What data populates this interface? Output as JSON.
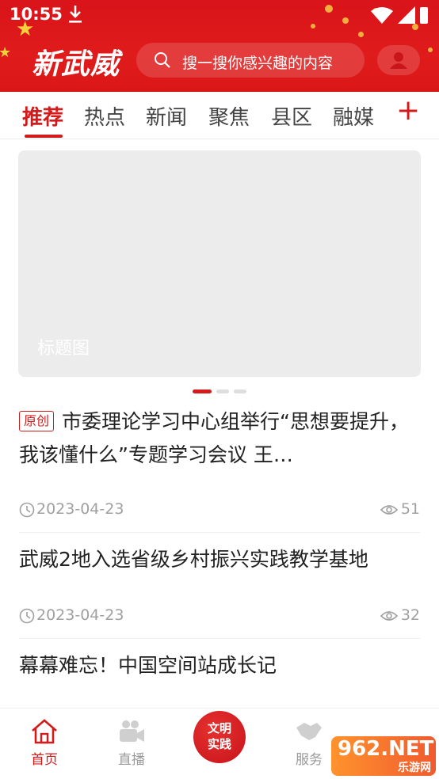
{
  "status_bar": {
    "time": "10:55"
  },
  "header": {
    "logo": "新武威",
    "search_placeholder": "搜一搜你感兴趣的内容"
  },
  "tabs": [
    {
      "label": "推荐",
      "active": true
    },
    {
      "label": "热点"
    },
    {
      "label": "新闻"
    },
    {
      "label": "聚焦"
    },
    {
      "label": "县区"
    },
    {
      "label": "融媒"
    }
  ],
  "tabs_add": "+",
  "banner": {
    "title": "标题图",
    "slides": 3,
    "active_slide": 1
  },
  "articles": [
    {
      "badge": "原创",
      "title": "市委理论学习中心组举行“思想要提升，我该懂什么”专题学习会议 王…",
      "date": "2023-04-23",
      "views": "51"
    },
    {
      "title": "武威2地入选省级乡村振兴实践教学基地",
      "date": "2023-04-23",
      "views": "32"
    },
    {
      "title": "幕幕难忘！中国空间站成长记"
    }
  ],
  "bottom_nav": [
    {
      "label": "首页",
      "icon": "home-icon",
      "active": true
    },
    {
      "label": "直播",
      "icon": "video-camera-icon"
    },
    {
      "label": "文明实践",
      "icon": "civilization-practice-badge"
    },
    {
      "label": "服务",
      "icon": "handshake-icon"
    }
  ],
  "center_badge": {
    "line1": "文明",
    "line2": "实践"
  },
  "watermark": {
    "text": "962.NET",
    "sub": "乐游网"
  },
  "colors": {
    "brand_red": "#d41b1b",
    "header_red": "#e01b1b",
    "muted": "#a0a0a0"
  }
}
